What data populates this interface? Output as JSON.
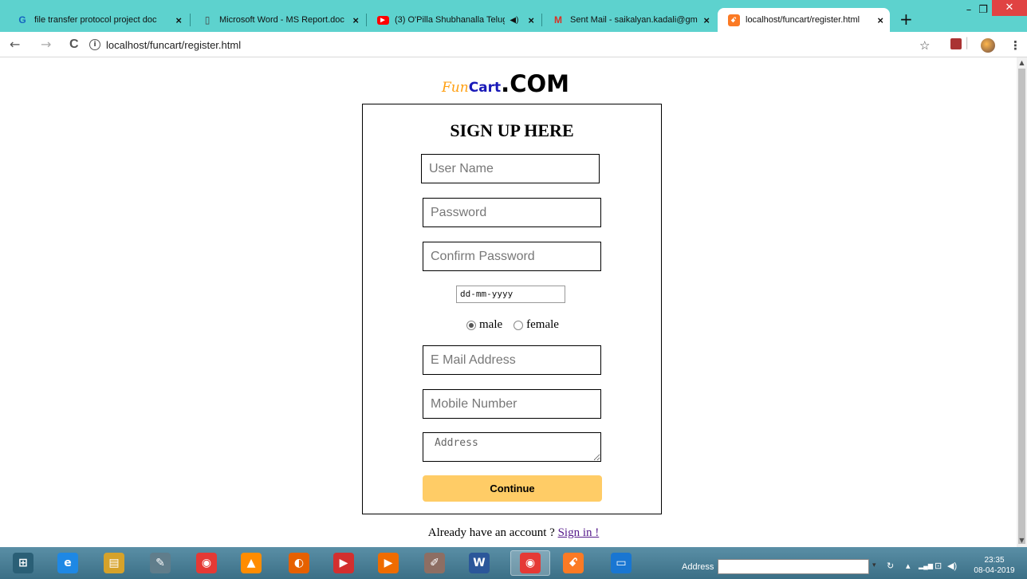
{
  "browser": {
    "tabs": [
      {
        "title": "file transfer protocol project doc",
        "favicon": "G",
        "favicon_color": "#4285f4",
        "active": false
      },
      {
        "title": "Microsoft Word - MS Report.doc",
        "favicon": "📄",
        "favicon_color": "#555555",
        "active": false
      },
      {
        "title": "(3) O'Pilla Shubhanalla Telug",
        "favicon": "▶",
        "favicon_color": "#ff0000",
        "active": false,
        "audio": "◀)"
      },
      {
        "title": "Sent Mail - saikalyan.kadali@gm",
        "favicon": "M",
        "favicon_color": "#d93025",
        "active": false
      },
      {
        "title": "localhost/funcart/register.html",
        "favicon": "ꗃ",
        "favicon_color": "#fb7a24",
        "active": true
      }
    ],
    "new_tab": "+",
    "window": {
      "minimize": "–",
      "restore": "❐",
      "close": "✕"
    },
    "nav": {
      "back": "←",
      "forward": "→",
      "reload": "C"
    },
    "url": "localhost/funcart/register.html",
    "info_icon": "i",
    "toolbar_icons": {
      "star": "☆",
      "extension": "⊟",
      "menu": "⋮"
    }
  },
  "page": {
    "logo": {
      "fun": "Fun",
      "cart": "Cart",
      "com": ".COM"
    },
    "heading": "SIGN UP HERE",
    "fields": {
      "username": {
        "placeholder": "User Name"
      },
      "password": {
        "placeholder": "Password"
      },
      "confirm_password": {
        "placeholder": "Confirm Password"
      },
      "dob": {
        "placeholder": "dd-mm-yyyy"
      },
      "email": {
        "placeholder": "E Mail Address"
      },
      "mobile": {
        "placeholder": "Mobile Number"
      },
      "address": {
        "placeholder": "Address"
      }
    },
    "gender": {
      "options": [
        {
          "label": "male",
          "selected": true
        },
        {
          "label": "female",
          "selected": false
        }
      ]
    },
    "continue_label": "Continue",
    "signin_prompt": "Already have an account ? ",
    "signin_link": "Sign in !"
  },
  "colors": {
    "logo_fun": "#ff9f10",
    "logo_cart": "#1a1ab8",
    "continue_button": "#ffcc66",
    "tab_strip": "#5dd2ce"
  },
  "taskbar": {
    "apps": [
      {
        "name": "windows-start",
        "glyph": "⊞",
        "color": "#2a5f76"
      },
      {
        "name": "internet-explorer",
        "glyph": "e",
        "color": "#1e88e5"
      },
      {
        "name": "file-explorer",
        "glyph": "▤",
        "color": "#d6a22a"
      },
      {
        "name": "notepad-app",
        "glyph": "✎",
        "color": "#607d8b"
      },
      {
        "name": "chrome",
        "glyph": "◉",
        "color": "#e53935"
      },
      {
        "name": "vlc",
        "glyph": "▲",
        "color": "#ff8c00"
      },
      {
        "name": "firefox",
        "glyph": "◐",
        "color": "#e66000"
      },
      {
        "name": "youtube",
        "glyph": "▶",
        "color": "#d32f2f"
      },
      {
        "name": "media-player",
        "glyph": "▶",
        "color": "#ef6c00"
      },
      {
        "name": "paint",
        "glyph": "✐",
        "color": "#8d6e63"
      },
      {
        "name": "word",
        "glyph": "W",
        "color": "#2b579a"
      },
      {
        "name": "chrome-active",
        "glyph": "◉",
        "color": "#e53935"
      },
      {
        "name": "xampp",
        "glyph": "ꗃ",
        "color": "#fb7a24"
      },
      {
        "name": "remote-desktop",
        "glyph": "▭",
        "color": "#1976d2"
      }
    ],
    "address_label": "Address",
    "tray": {
      "chevron": "▴",
      "signal": "▂▄▆",
      "network": "⊡",
      "volume": "◀)"
    },
    "time": "23:35",
    "date": "08-04-2019"
  }
}
